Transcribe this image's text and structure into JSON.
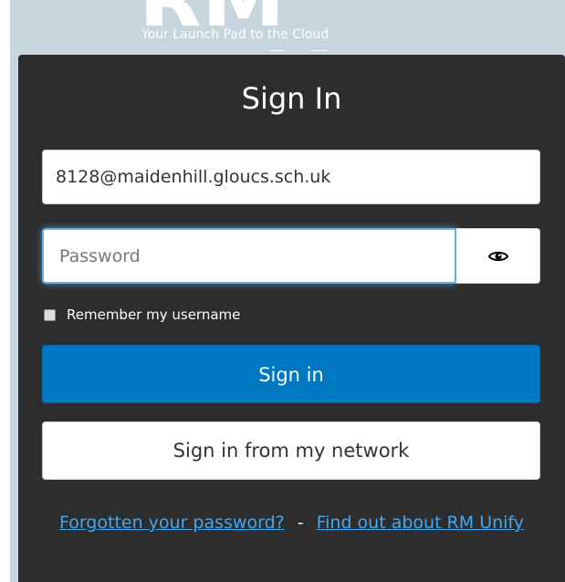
{
  "header": {
    "logo_text": "RM Unify",
    "tagline": "Your Launch Pad to the Cloud"
  },
  "login": {
    "title": "Sign In",
    "username_value": "8128@maidenhill.gloucs.sch.uk",
    "password_placeholder": "Password",
    "show_password_icon": "eye-icon",
    "remember_label": "Remember my username",
    "remember_checked": false,
    "sign_in_label": "Sign in",
    "network_sign_in_label": "Sign in from my network"
  },
  "links": {
    "forgot_password": "Forgotten your password?",
    "separator": "-",
    "find_out": "Find out about RM Unify"
  },
  "colors": {
    "page_bg": "#c7d5dd",
    "card_bg": "#2d2d2d",
    "primary": "#0078c1",
    "link": "#3fa9f5"
  }
}
